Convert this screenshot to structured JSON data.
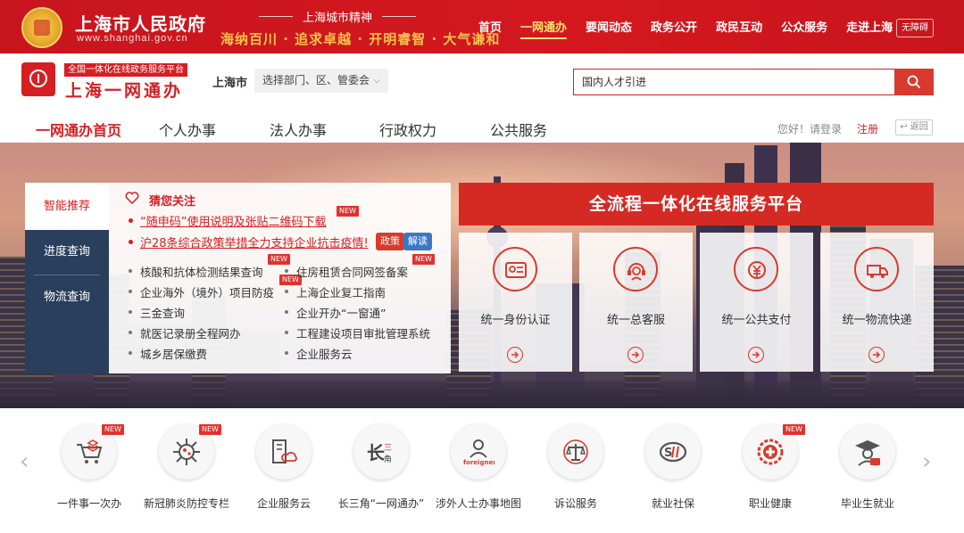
{
  "top_bar": {
    "gov_title": "上海市人民政府",
    "gov_url": "www.shanghai.gov.cn",
    "spirit_title": "上海城市精神",
    "spirit_text": "海纳百川 · 追求卓越 · 开明睿智 · 大气谦和",
    "nav": [
      "首页",
      "一网通办",
      "要闻动态",
      "政务公开",
      "政民互动",
      "公众服务",
      "走进上海"
    ],
    "active_nav": "一网通办",
    "barrier_free": "无障碍"
  },
  "header": {
    "subtitle_tag": "全国一体化在线政务服务平台",
    "brand": "上海一网通办",
    "city": "上海市",
    "dept_select": "选择部门、区、管委会",
    "search_value": "国内人才引进"
  },
  "main_nav": {
    "items": [
      "一网通办首页",
      "个人办事",
      "法人办事",
      "行政权力",
      "公共服务"
    ],
    "greeting": "您好！请登录",
    "register": "注册",
    "back": "返回"
  },
  "side_tabs": [
    "智能推荐",
    "进度查询",
    "物流查询"
  ],
  "recommend": {
    "title": "猜您关注",
    "hot_links": [
      "“随申码”使用说明及张贴二维码下载",
      "沪28条综合政策举措全力支持企业抗击疫情!"
    ],
    "tags": [
      "政策",
      "解读"
    ],
    "new_badge": "NEW",
    "left_links": [
      "核酸和抗体检测结果查询",
      "企业海外（境外）项目防疫",
      "三金查询",
      "就医记录册全程网办",
      "城乡居保缴费"
    ],
    "right_links": [
      "住房租赁合同网签备案",
      "上海企业复工指南",
      "企业开办“一窗通”",
      "工程建设项目审批管理系统",
      "企业服务云"
    ]
  },
  "platform": {
    "title": "全流程一体化在线服务平台",
    "cards": [
      {
        "label": "统一身份认证",
        "icon": "id-card-icon"
      },
      {
        "label": "统一总客服",
        "icon": "customer-service-icon"
      },
      {
        "label": "统一公共支付",
        "icon": "payment-icon"
      },
      {
        "label": "统一物流快递",
        "icon": "delivery-truck-icon"
      }
    ]
  },
  "quick_services": [
    {
      "label": "一件事一次办",
      "icon": "cart-layers-icon",
      "new": true
    },
    {
      "label": "新冠肺炎防控专栏",
      "icon": "virus-icon",
      "new": true
    },
    {
      "label": "企业服务云",
      "icon": "enterprise-cloud-icon",
      "new": false
    },
    {
      "label": "长三角“一网通办”",
      "icon": "yangtze-delta-icon",
      "new": false
    },
    {
      "label": "涉外人士办事地图",
      "icon": "foreigners-icon",
      "new": false
    },
    {
      "label": "诉讼服务",
      "icon": "justice-scale-icon",
      "new": false
    },
    {
      "label": "就业社保",
      "icon": "social-security-icon",
      "new": false
    },
    {
      "label": "职业健康",
      "icon": "occupational-health-icon",
      "new": true
    },
    {
      "label": "毕业生就业",
      "icon": "graduate-icon",
      "new": false
    }
  ],
  "colors": {
    "brand_red": "#d51f22",
    "nav_gold": "#ffe36b",
    "tab_navy": "#2a3f5b",
    "tag_blue": "#3a78c5"
  }
}
